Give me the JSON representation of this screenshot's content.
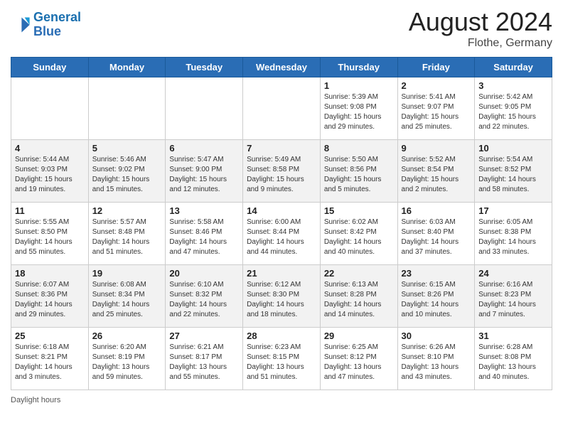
{
  "header": {
    "logo_line1": "General",
    "logo_line2": "Blue",
    "month_year": "August 2024",
    "location": "Flothe, Germany"
  },
  "days_of_week": [
    "Sunday",
    "Monday",
    "Tuesday",
    "Wednesday",
    "Thursday",
    "Friday",
    "Saturday"
  ],
  "weeks": [
    [
      {
        "day": "",
        "info": ""
      },
      {
        "day": "",
        "info": ""
      },
      {
        "day": "",
        "info": ""
      },
      {
        "day": "",
        "info": ""
      },
      {
        "day": "1",
        "info": "Sunrise: 5:39 AM\nSunset: 9:08 PM\nDaylight: 15 hours\nand 29 minutes."
      },
      {
        "day": "2",
        "info": "Sunrise: 5:41 AM\nSunset: 9:07 PM\nDaylight: 15 hours\nand 25 minutes."
      },
      {
        "day": "3",
        "info": "Sunrise: 5:42 AM\nSunset: 9:05 PM\nDaylight: 15 hours\nand 22 minutes."
      }
    ],
    [
      {
        "day": "4",
        "info": "Sunrise: 5:44 AM\nSunset: 9:03 PM\nDaylight: 15 hours\nand 19 minutes."
      },
      {
        "day": "5",
        "info": "Sunrise: 5:46 AM\nSunset: 9:02 PM\nDaylight: 15 hours\nand 15 minutes."
      },
      {
        "day": "6",
        "info": "Sunrise: 5:47 AM\nSunset: 9:00 PM\nDaylight: 15 hours\nand 12 minutes."
      },
      {
        "day": "7",
        "info": "Sunrise: 5:49 AM\nSunset: 8:58 PM\nDaylight: 15 hours\nand 9 minutes."
      },
      {
        "day": "8",
        "info": "Sunrise: 5:50 AM\nSunset: 8:56 PM\nDaylight: 15 hours\nand 5 minutes."
      },
      {
        "day": "9",
        "info": "Sunrise: 5:52 AM\nSunset: 8:54 PM\nDaylight: 15 hours\nand 2 minutes."
      },
      {
        "day": "10",
        "info": "Sunrise: 5:54 AM\nSunset: 8:52 PM\nDaylight: 14 hours\nand 58 minutes."
      }
    ],
    [
      {
        "day": "11",
        "info": "Sunrise: 5:55 AM\nSunset: 8:50 PM\nDaylight: 14 hours\nand 55 minutes."
      },
      {
        "day": "12",
        "info": "Sunrise: 5:57 AM\nSunset: 8:48 PM\nDaylight: 14 hours\nand 51 minutes."
      },
      {
        "day": "13",
        "info": "Sunrise: 5:58 AM\nSunset: 8:46 PM\nDaylight: 14 hours\nand 47 minutes."
      },
      {
        "day": "14",
        "info": "Sunrise: 6:00 AM\nSunset: 8:44 PM\nDaylight: 14 hours\nand 44 minutes."
      },
      {
        "day": "15",
        "info": "Sunrise: 6:02 AM\nSunset: 8:42 PM\nDaylight: 14 hours\nand 40 minutes."
      },
      {
        "day": "16",
        "info": "Sunrise: 6:03 AM\nSunset: 8:40 PM\nDaylight: 14 hours\nand 37 minutes."
      },
      {
        "day": "17",
        "info": "Sunrise: 6:05 AM\nSunset: 8:38 PM\nDaylight: 14 hours\nand 33 minutes."
      }
    ],
    [
      {
        "day": "18",
        "info": "Sunrise: 6:07 AM\nSunset: 8:36 PM\nDaylight: 14 hours\nand 29 minutes."
      },
      {
        "day": "19",
        "info": "Sunrise: 6:08 AM\nSunset: 8:34 PM\nDaylight: 14 hours\nand 25 minutes."
      },
      {
        "day": "20",
        "info": "Sunrise: 6:10 AM\nSunset: 8:32 PM\nDaylight: 14 hours\nand 22 minutes."
      },
      {
        "day": "21",
        "info": "Sunrise: 6:12 AM\nSunset: 8:30 PM\nDaylight: 14 hours\nand 18 minutes."
      },
      {
        "day": "22",
        "info": "Sunrise: 6:13 AM\nSunset: 8:28 PM\nDaylight: 14 hours\nand 14 minutes."
      },
      {
        "day": "23",
        "info": "Sunrise: 6:15 AM\nSunset: 8:26 PM\nDaylight: 14 hours\nand 10 minutes."
      },
      {
        "day": "24",
        "info": "Sunrise: 6:16 AM\nSunset: 8:23 PM\nDaylight: 14 hours\nand 7 minutes."
      }
    ],
    [
      {
        "day": "25",
        "info": "Sunrise: 6:18 AM\nSunset: 8:21 PM\nDaylight: 14 hours\nand 3 minutes."
      },
      {
        "day": "26",
        "info": "Sunrise: 6:20 AM\nSunset: 8:19 PM\nDaylight: 13 hours\nand 59 minutes."
      },
      {
        "day": "27",
        "info": "Sunrise: 6:21 AM\nSunset: 8:17 PM\nDaylight: 13 hours\nand 55 minutes."
      },
      {
        "day": "28",
        "info": "Sunrise: 6:23 AM\nSunset: 8:15 PM\nDaylight: 13 hours\nand 51 minutes."
      },
      {
        "day": "29",
        "info": "Sunrise: 6:25 AM\nSunset: 8:12 PM\nDaylight: 13 hours\nand 47 minutes."
      },
      {
        "day": "30",
        "info": "Sunrise: 6:26 AM\nSunset: 8:10 PM\nDaylight: 13 hours\nand 43 minutes."
      },
      {
        "day": "31",
        "info": "Sunrise: 6:28 AM\nSunset: 8:08 PM\nDaylight: 13 hours\nand 40 minutes."
      }
    ]
  ],
  "footer": {
    "daylight_label": "Daylight hours"
  }
}
